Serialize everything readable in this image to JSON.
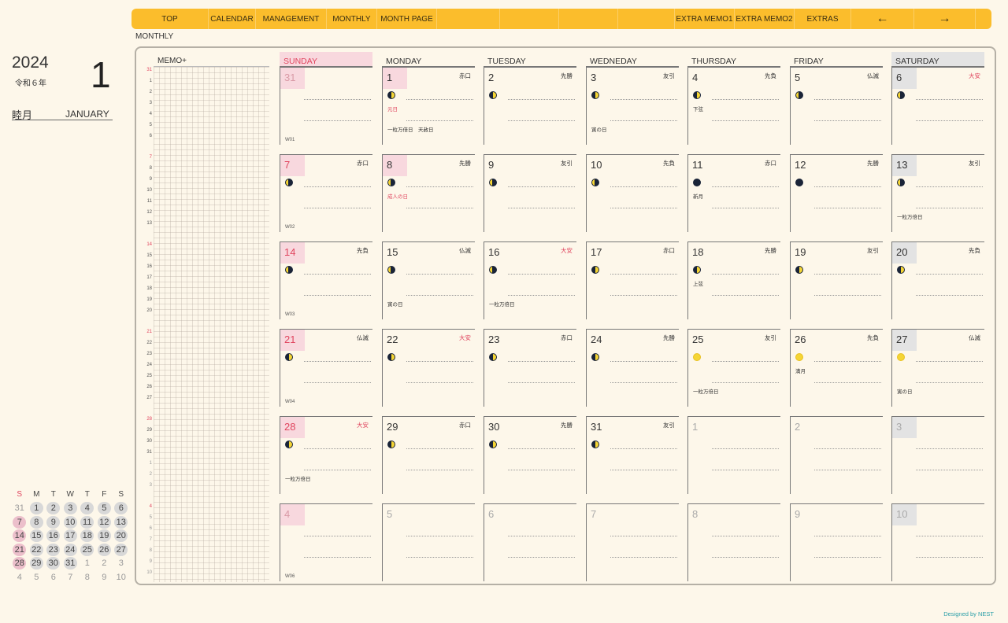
{
  "nav": {
    "items": [
      {
        "label": "TOP",
        "w": 98
      },
      {
        "label": "CALENDAR",
        "w": 60
      },
      {
        "label": "MANAGEMENT",
        "w": 90
      },
      {
        "label": "MONTHLY",
        "w": 64
      },
      {
        "label": "MONTH PAGE",
        "w": 76
      },
      {
        "label": "",
        "w": 80
      },
      {
        "label": "",
        "w": 75
      },
      {
        "label": "",
        "w": 75
      },
      {
        "label": "",
        "w": 72
      },
      {
        "label": "EXTRA MEMO1",
        "w": 76
      },
      {
        "label": "EXTRA MEMO2",
        "w": 76
      },
      {
        "label": "EXTRAS",
        "w": 72
      },
      {
        "label": "←",
        "w": 80
      },
      {
        "label": "→",
        "w": 78
      }
    ]
  },
  "page_label": "MONTHLY",
  "year": "2024",
  "era": "令和６年",
  "month_number": "1",
  "month_jp": "睦月",
  "month_en": "JANUARY",
  "memo_label": "MEMO+",
  "memo_numbers": [
    "31",
    "1",
    "2",
    "3",
    "4",
    "5",
    "6",
    "7",
    "8",
    "9",
    "10",
    "11",
    "12",
    "13",
    "14",
    "15",
    "16",
    "17",
    "18",
    "19",
    "20",
    "21",
    "22",
    "23",
    "24",
    "25",
    "26",
    "27",
    "28",
    "29",
    "30",
    "31",
    "1",
    "2",
    "3",
    "4",
    "5",
    "6",
    "7",
    "8",
    "9",
    "10"
  ],
  "day_headers": [
    "SUNDAY",
    "MONDAY",
    "TUESDAY",
    "WEDNEDAY",
    "THURSDAY",
    "FRIDAY",
    "SATURDAY"
  ],
  "mini_calendar": {
    "headers": [
      "S",
      "M",
      "T",
      "W",
      "T",
      "F",
      "S"
    ],
    "weeks": [
      [
        "31",
        "1",
        "2",
        "3",
        "4",
        "5",
        "6"
      ],
      [
        "7",
        "8",
        "9",
        "10",
        "11",
        "12",
        "13"
      ],
      [
        "14",
        "15",
        "16",
        "17",
        "18",
        "19",
        "20"
      ],
      [
        "21",
        "22",
        "23",
        "24",
        "25",
        "26",
        "27"
      ],
      [
        "28",
        "29",
        "30",
        "31",
        "1",
        "2",
        "3"
      ],
      [
        "4",
        "5",
        "6",
        "7",
        "8",
        "9",
        "10"
      ]
    ]
  },
  "weeks": [
    {
      "label": "W01",
      "days": [
        {
          "n": "31",
          "out": true,
          "r": "",
          "moon": ""
        },
        {
          "n": "1",
          "hol": true,
          "r": "赤口",
          "moon": "waxing",
          "notes": [
            {
              "t": "元日",
              "red": true
            },
            {
              "t": "一粒万倍日　天赦日"
            }
          ]
        },
        {
          "n": "2",
          "r": "先勝",
          "moon": "waxing"
        },
        {
          "n": "3",
          "r": "友引",
          "moon": "waxing",
          "notes": [
            {
              "t": ""
            },
            {
              "t": "寅の日"
            }
          ]
        },
        {
          "n": "4",
          "r": "先負",
          "moon": "half",
          "notes": [
            {
              "t": "下弦"
            }
          ]
        },
        {
          "n": "5",
          "r": "仏滅",
          "moon": "waning"
        },
        {
          "n": "6",
          "r": "大安",
          "rred": true,
          "moon": "waning"
        }
      ]
    },
    {
      "label": "W02",
      "days": [
        {
          "n": "7",
          "r": "赤口",
          "moon": "waning"
        },
        {
          "n": "8",
          "hol": true,
          "r": "先勝",
          "moon": "waning",
          "notes": [
            {
              "t": "成人の日",
              "red": true
            }
          ]
        },
        {
          "n": "9",
          "r": "友引",
          "moon": "waning"
        },
        {
          "n": "10",
          "r": "先負",
          "moon": "waning"
        },
        {
          "n": "11",
          "r": "赤口",
          "moon": "new",
          "notes": [
            {
              "t": "新月"
            }
          ]
        },
        {
          "n": "12",
          "r": "先勝",
          "moon": "new"
        },
        {
          "n": "13",
          "r": "友引",
          "moon": "waning",
          "notes": [
            {
              "t": ""
            },
            {
              "t": "一粒万倍日"
            }
          ]
        }
      ]
    },
    {
      "label": "W03",
      "days": [
        {
          "n": "14",
          "r": "先負",
          "moon": "waning"
        },
        {
          "n": "15",
          "r": "仏滅",
          "moon": "waning",
          "notes": [
            {
              "t": ""
            },
            {
              "t": "寅の日"
            }
          ]
        },
        {
          "n": "16",
          "r": "大安",
          "rred": true,
          "moon": "waning",
          "notes": [
            {
              "t": ""
            },
            {
              "t": "一粒万倍日"
            }
          ]
        },
        {
          "n": "17",
          "r": "赤口",
          "moon": "waxing"
        },
        {
          "n": "18",
          "r": "先勝",
          "moon": "half",
          "notes": [
            {
              "t": "上弦"
            }
          ]
        },
        {
          "n": "19",
          "r": "友引",
          "moon": "waxing"
        },
        {
          "n": "20",
          "r": "先負",
          "moon": "waxing"
        }
      ]
    },
    {
      "label": "W04",
      "days": [
        {
          "n": "21",
          "r": "仏滅",
          "moon": "waxing"
        },
        {
          "n": "22",
          "r": "大安",
          "rred": true,
          "moon": "waxing"
        },
        {
          "n": "23",
          "r": "赤口",
          "moon": "waxing"
        },
        {
          "n": "24",
          "r": "先勝",
          "moon": "waxing"
        },
        {
          "n": "25",
          "r": "友引",
          "moon": "full",
          "notes": [
            {
              "t": ""
            },
            {
              "t": "一粒万倍日"
            }
          ]
        },
        {
          "n": "26",
          "r": "先負",
          "moon": "full",
          "notes": [
            {
              "t": "満月"
            }
          ]
        },
        {
          "n": "27",
          "r": "仏滅",
          "moon": "full",
          "notes": [
            {
              "t": ""
            },
            {
              "t": "寅の日"
            }
          ]
        }
      ]
    },
    {
      "label": "",
      "days": [
        {
          "n": "28",
          "r": "大安",
          "rred": true,
          "moon": "waxing",
          "notes": [
            {
              "t": ""
            },
            {
              "t": "一粒万倍日"
            }
          ]
        },
        {
          "n": "29",
          "r": "赤口",
          "moon": "waxing"
        },
        {
          "n": "30",
          "r": "先勝",
          "moon": "waxing"
        },
        {
          "n": "31",
          "r": "友引",
          "moon": "waxing"
        },
        {
          "n": "1",
          "out": true,
          "r": "",
          "moon": ""
        },
        {
          "n": "2",
          "out": true,
          "r": "",
          "moon": ""
        },
        {
          "n": "3",
          "out": true,
          "r": "",
          "moon": ""
        }
      ]
    },
    {
      "label": "W06",
      "days": [
        {
          "n": "4",
          "out": true,
          "r": "",
          "moon": ""
        },
        {
          "n": "5",
          "out": true,
          "r": "",
          "moon": ""
        },
        {
          "n": "6",
          "out": true,
          "r": "",
          "moon": ""
        },
        {
          "n": "7",
          "out": true,
          "r": "",
          "moon": ""
        },
        {
          "n": "8",
          "out": true,
          "r": "",
          "moon": ""
        },
        {
          "n": "9",
          "out": true,
          "r": "",
          "moon": ""
        },
        {
          "n": "10",
          "out": true,
          "r": "",
          "moon": ""
        }
      ]
    }
  ],
  "footer": "Designed by NEST",
  "colors": {
    "accent": "#fbbd2c",
    "sunday": "#e0445e",
    "sunday_bg": "#f8d8de",
    "saturday_bg": "#e3e3e3",
    "footer": "#2c9fa8"
  }
}
